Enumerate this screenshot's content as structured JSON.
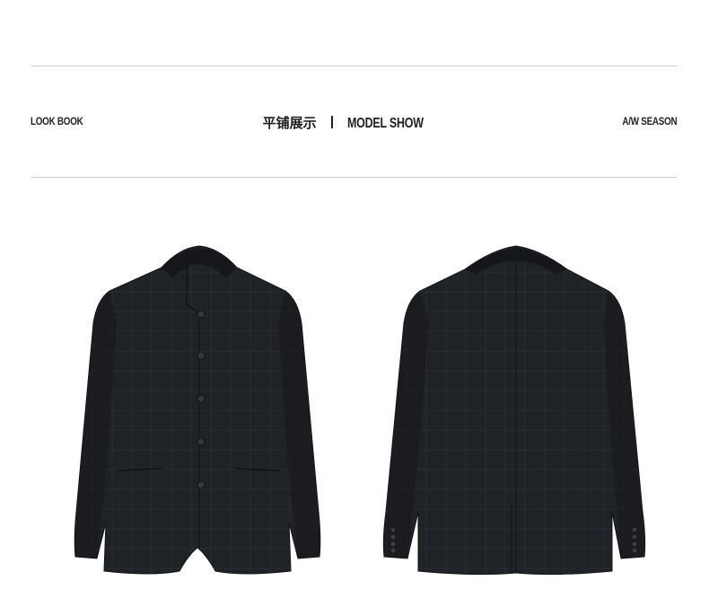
{
  "header": {
    "left_label": "LOOK BOOK",
    "center_cn": "平铺展示",
    "center_en": "MODEL SHOW",
    "right_label": "A/W SEASON"
  },
  "colors": {
    "rule": "#cfcfcf",
    "fabric": "#1e2126",
    "fabric_shadow": "#15171b",
    "button": "#3a3d42"
  }
}
